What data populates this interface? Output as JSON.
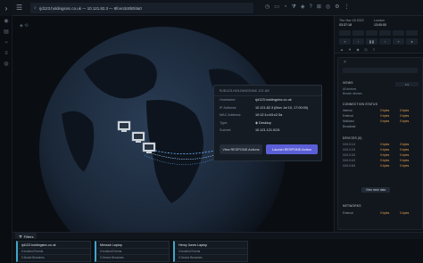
{
  "topbar": {
    "search_text": "rjd123.holdingsinc.co.uk — 10.121.82.3 — 8fcen3c8b0l4a0"
  },
  "breadcrumb": "◈ ⟲",
  "popup": {
    "heading": "RJD123.HOLDINGSINC.CO.UK",
    "rows": [
      {
        "k": "Hostname:",
        "v": "rjd123.holdingsinc.co.uk"
      },
      {
        "k": "IP Address:",
        "v": "10.121.82.3 (Mon Jul 10, 17:00:00)"
      },
      {
        "k": "MAC Address:",
        "v": "10:12:1c:b3:c2:3a"
      },
      {
        "k": "Type:",
        "v": "◈ Desktop"
      },
      {
        "k": "Subnet:",
        "v": "10.121.121.0/24"
      }
    ],
    "view_button": "View RESPOND Actions",
    "launch_button": "Launch RESPOND Action"
  },
  "right": {
    "clock_left": {
      "line1": "Thu Nov 18 2022",
      "line2": "03:37:18"
    },
    "clock_right": {
      "line1": "London",
      "line2": "13:00:00"
    },
    "views_label": "VIEWS",
    "views_items": [
      "All devices",
      "Breach devices"
    ],
    "conn_label": "CONNECTION STATUS",
    "conn_rows": [
      {
        "a": "Internal",
        "b": "0 bytes",
        "c": "0 bytes"
      },
      {
        "a": "External",
        "b": "0 bytes",
        "c": "0 bytes"
      },
      {
        "a": "Multicast",
        "b": "0 bytes",
        "c": "0 bytes"
      },
      {
        "a": "Broadcast",
        "b": "",
        "c": ""
      }
    ],
    "devices_label": "DEVICES (5)",
    "device_rows": [
      {
        "a": "10.0.0.1.0",
        "b": "0 bytes",
        "c": "0 bytes"
      },
      {
        "a": "10.0.0.2.0",
        "b": "0 bytes",
        "c": "0 bytes"
      },
      {
        "a": "10.0.0.3.0",
        "b": "0 bytes",
        "c": "0 bytes"
      },
      {
        "a": "10.0.0.4.0",
        "b": "0 bytes",
        "c": "0 bytes"
      },
      {
        "a": "10.0.0.5.0",
        "b": "0 bytes",
        "c": "0 bytes"
      }
    ],
    "more_label": "View more data",
    "networks_label": "NETWORKS",
    "networks_rows": [
      {
        "a": "External",
        "b": "0 bytes",
        "c": "0 bytes"
      }
    ]
  },
  "filters_label": "Filters",
  "cards": [
    {
      "title": "rjd123.holdingsinc.co.uk",
      "lines": [
        "0 incident Events",
        "0 Model Breaches",
        "Online"
      ]
    },
    {
      "title": "Mensah Laptop",
      "lines": [
        "0 incident Events",
        "0 Device Breaches",
        "Online"
      ]
    },
    {
      "title": "Henry Jones Laptop",
      "lines": [
        "0 incident Events",
        "0 Device Breaches",
        "Online"
      ]
    }
  ]
}
